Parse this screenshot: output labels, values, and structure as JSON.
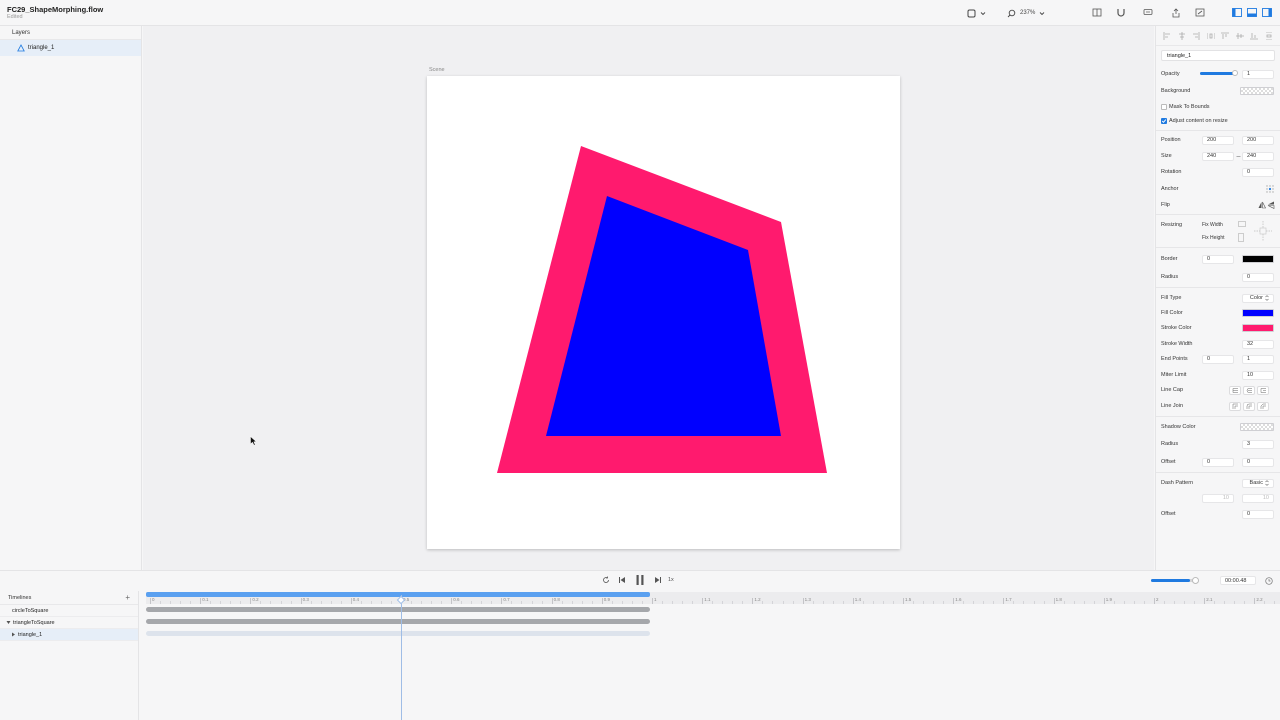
{
  "app": {
    "document_title": "FC29_ShapeMorphing.flow",
    "status": "Edited"
  },
  "toolbar": {
    "zoom": "237%"
  },
  "layers": {
    "header": "Layers",
    "items": [
      {
        "name": "triangle_1"
      }
    ]
  },
  "canvas": {
    "scene_label": "Scene"
  },
  "inspector": {
    "name": "triangle_1",
    "opacity": {
      "label": "Opacity",
      "value": "1",
      "fraction": 1.0
    },
    "background": {
      "label": "Background"
    },
    "mask_to_bounds": {
      "label": "Mask To Bounds",
      "checked": false
    },
    "adjust_content": {
      "label": "Adjust content on resize",
      "checked": true
    },
    "position": {
      "label": "Position",
      "x": "200",
      "y": "200"
    },
    "size": {
      "label": "Size",
      "w": "240",
      "h": "240"
    },
    "rotation": {
      "label": "Rotation",
      "value": "0"
    },
    "anchor": {
      "label": "Anchor"
    },
    "flip": {
      "label": "Flip"
    },
    "resizing": {
      "label": "Resizing",
      "fix_width": "Fix Width",
      "fix_height": "Fix Height"
    },
    "border": {
      "label": "Border",
      "value": "0",
      "color": "#000000"
    },
    "radius": {
      "label": "Radius",
      "value": "0"
    },
    "fill_type": {
      "label": "Fill Type",
      "value": "Color"
    },
    "fill_color": {
      "label": "Fill Color",
      "color": "#0000FF"
    },
    "stroke_color": {
      "label": "Stroke Color",
      "color": "#FF1A6E"
    },
    "stroke_width": {
      "label": "Stroke Width",
      "value": "32"
    },
    "end_points": {
      "label": "End Points",
      "start": "0",
      "end": "1"
    },
    "miter_limit": {
      "label": "Miter Limit",
      "value": "10"
    },
    "line_cap": {
      "label": "Line Cap"
    },
    "line_join": {
      "label": "Line Join"
    },
    "shadow_color": {
      "label": "Shadow Color"
    },
    "shadow_radius": {
      "label": "Radius",
      "value": "3"
    },
    "shadow_offset": {
      "label": "Offset",
      "x": "0",
      "y": "0"
    },
    "dash_pattern": {
      "label": "Dash Pattern",
      "value": "Basic",
      "a": "10",
      "b": "10"
    },
    "dash_offset": {
      "label": "Offset",
      "value": "0"
    }
  },
  "playback": {
    "speed": "1x",
    "time": "00:00.48",
    "volume_fraction": 0.85
  },
  "timelines": {
    "header": "Timelines",
    "items": [
      {
        "name": "circleToSquare"
      },
      {
        "name": "triangleToSquare"
      },
      {
        "name": "triangle_1"
      }
    ],
    "ruler_ticks": [
      "0",
      "0.1",
      "0.2",
      "0.3",
      "0.4",
      "0.5",
      "0.6",
      "0.7",
      "0.8",
      "0.9",
      "1",
      "1.1",
      "1.2",
      "1.3",
      "1.4",
      "1.5",
      "1.6",
      "1.7",
      "1.8",
      "1.9",
      "2",
      "2.1",
      "2.2"
    ],
    "playhead_fraction": 0.5
  },
  "colors": {
    "accent": "#1F7AE0",
    "stroke": "#FF1A6E",
    "fill": "#0000FF"
  }
}
